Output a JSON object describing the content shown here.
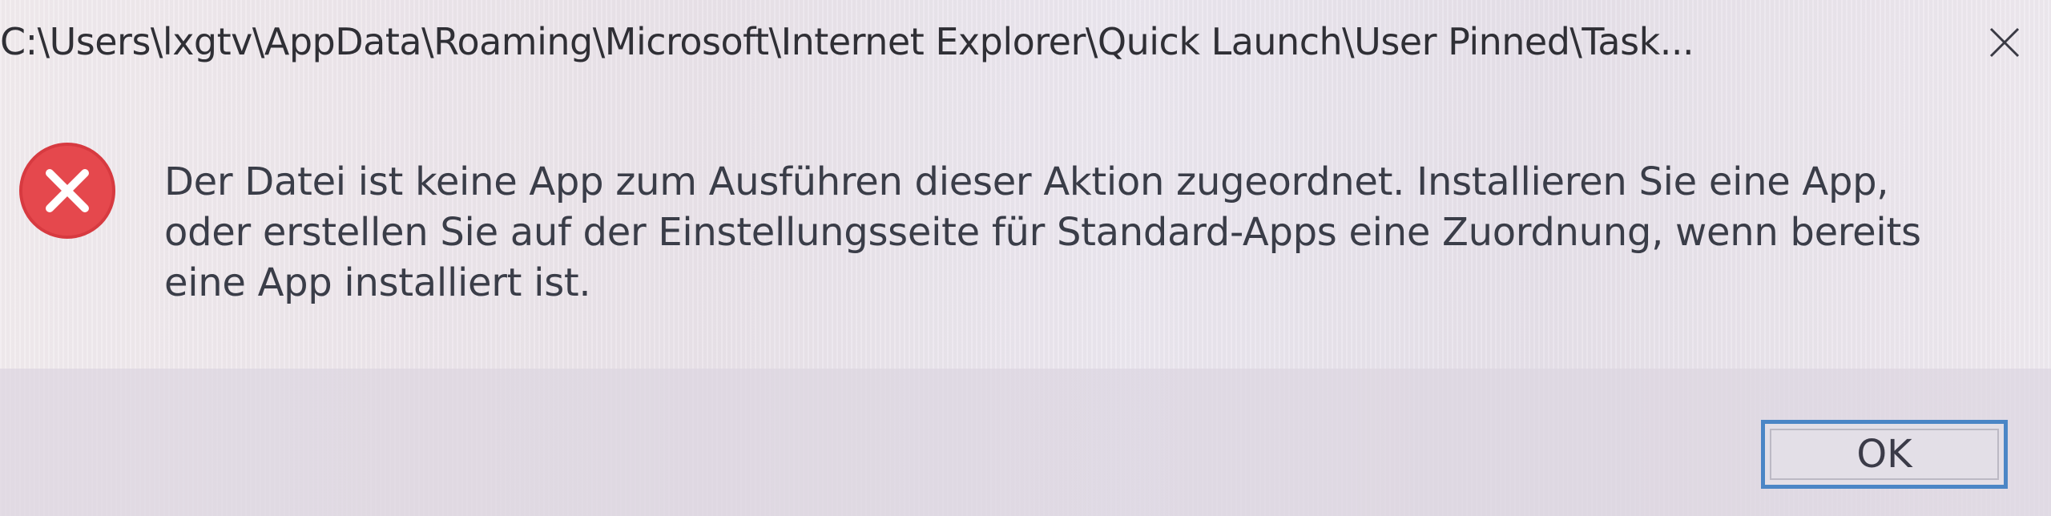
{
  "window": {
    "title": "C:\\Users\\lxgtv\\AppData\\Roaming\\Microsoft\\Internet Explorer\\Quick Launch\\User Pinned\\Task..."
  },
  "message": {
    "icon": "error-icon",
    "lines": [
      "Der Datei ist keine App zum Ausführen dieser Aktion zugeordnet. Installieren Sie eine App,",
      "oder erstellen Sie auf der Einstellungsseite für Standard-Apps eine Zuordnung, wenn bereits",
      "eine App installiert ist."
    ]
  },
  "buttons": {
    "ok_label": "OK"
  },
  "colors": {
    "error_red": "#e5484d",
    "accent_blue": "#4b86c6"
  }
}
